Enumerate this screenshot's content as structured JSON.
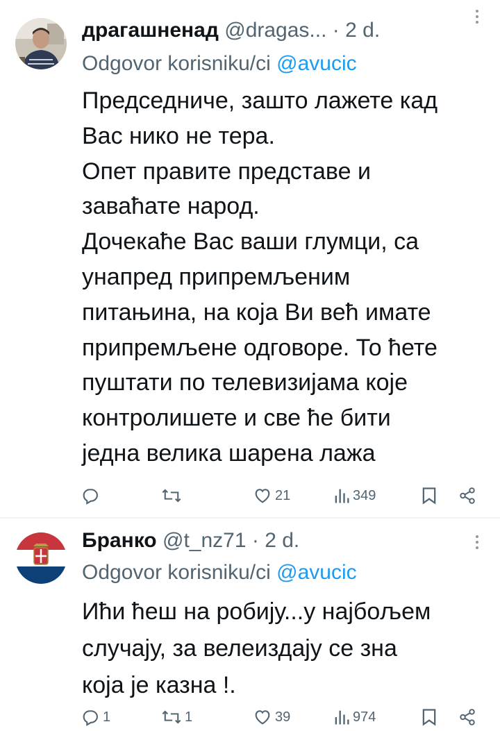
{
  "tweets": [
    {
      "name": "драгашненад",
      "handle": "@dragas...",
      "dot": "·",
      "time": "2 d.",
      "reply_prefix": "Odgovor korisniku/ci",
      "reply_mention": "@avucic",
      "text": "Председниче, зашто лажете кад\nВас нико не тера.\nОпет правите представе и\nзаваћате народ.\nДочекаће Вас ваши глумци, са\nунапред припремљеним\nпитањина, на која Ви већ имате\nприпремљене одговоре. То ћете\nпуштати по телевизијама које\nконтролишете и све ће бити\nједна велика шарена лажа",
      "replies": "",
      "retweets": "",
      "likes": "21",
      "views": "349"
    },
    {
      "name": "Бранко",
      "handle": "@t_nz71",
      "dot": "·",
      "time": "2 d.",
      "reply_prefix": "Odgovor korisniku/ci",
      "reply_mention": "@avucic",
      "text": "Ићи ћеш на робију...у најбољем\nслучају, за велеиздају се зна\nкоја је казна !.",
      "replies": "1",
      "retweets": "1",
      "likes": "39",
      "views": "974"
    }
  ],
  "icons": {
    "reply": "reply-icon",
    "retweet": "retweet-icon",
    "like": "heart-icon",
    "views": "views-icon",
    "bookmark": "bookmark-icon",
    "share": "share-icon",
    "more": "more-icon"
  },
  "colors": {
    "text": "#0f1419",
    "secondary": "#536471",
    "mention": "#1d9bf0",
    "divider": "#eff3f4"
  }
}
